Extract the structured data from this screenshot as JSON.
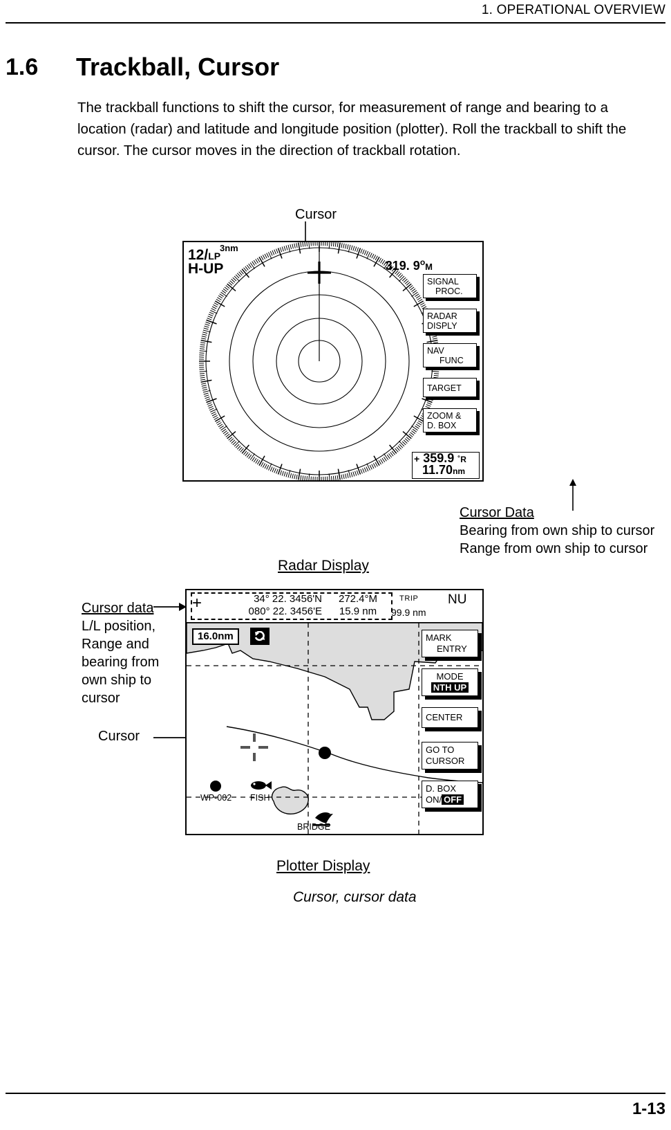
{
  "page": {
    "running_head": "1. OPERATIONAL OVERVIEW",
    "page_number": "1-13"
  },
  "section": {
    "number": "1.6",
    "title": "Trackball, Cursor",
    "paragraph": "The trackball functions to shift the cursor, for measurement of range and bearing to a location (radar) and latitude and longitude position (plotter). Roll the trackball to shift the cursor. The cursor moves in the direction of trackball rotation."
  },
  "radar": {
    "cursor_callout": "Cursor",
    "pulse_length": "12/",
    "pulse_length_sub": "LP",
    "range_scale": "3nm",
    "orientation": "H-UP",
    "heading_value": "319. 9",
    "heading_unit_deg": "o",
    "heading_unit_mag": "M",
    "soft_keys": [
      {
        "line1": "SIGNAL",
        "line2": "PROC."
      },
      {
        "line1": "RADAR",
        "line2": "DISPLY"
      },
      {
        "line1": "NAV",
        "line2": "FUNC"
      },
      {
        "line1": "TARGET",
        "line2": ""
      },
      {
        "line1": "ZOOM &",
        "line2": "D. BOX"
      }
    ],
    "cursor_data": {
      "plus": "+",
      "bearing": "359.9",
      "bearing_unit": "˚R",
      "range": "11.70",
      "range_unit": "nm"
    },
    "cursor_data_callout": {
      "heading": "Cursor Data",
      "line1": "Bearing from own ship to cursor",
      "line2": "Range from own ship to cursor"
    },
    "caption": "Radar Display"
  },
  "plotter": {
    "cursor_data_callout": {
      "heading": "Cursor data",
      "line1": "L/L position,",
      "line2": "Range and",
      "line3": "bearing from",
      "line4": "own ship to",
      "line5": "cursor"
    },
    "cursor_callout": "Cursor",
    "header": {
      "plus": "+",
      "latitude": "34° 22. 3456'N",
      "longitude": "080° 22. 3456'E",
      "bearing": "272.4°M",
      "range": "15.9 nm",
      "trip_label": "TRIP",
      "trip_value": "99.9 nm",
      "mode_indicator": "NU"
    },
    "range_scale": "16.0nm",
    "icon_name": "rotate-icon",
    "soft_keys": [
      {
        "line1": "MARK",
        "line2": "ENTRY",
        "inverse": ""
      },
      {
        "line1": "MODE",
        "line2": "",
        "inverse": "NTH UP"
      },
      {
        "line1": "CENTER",
        "line2": "",
        "inverse": ""
      },
      {
        "line1": "GO TO",
        "line2": "CURSOR",
        "inverse": ""
      },
      {
        "line1": "D. BOX",
        "line2": "ON/",
        "inverse": "OFF"
      }
    ],
    "map_labels": {
      "waypoint": "WP-002",
      "fish": "FISH",
      "bridge": "BRIDGE"
    },
    "caption": "Plotter Display"
  },
  "figure_caption": "Cursor, cursor data",
  "colors": {
    "ink": "#000000",
    "paper": "#ffffff",
    "land_fill": "#dddddd"
  }
}
